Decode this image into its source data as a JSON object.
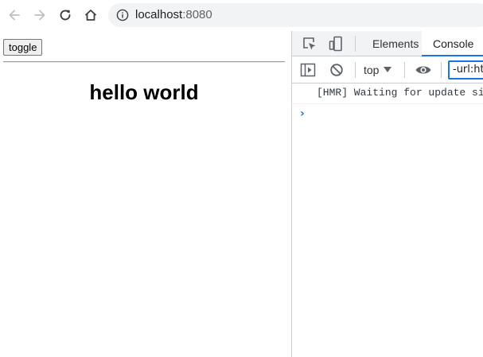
{
  "browser": {
    "url_host": "localhost",
    "url_port": ":8080",
    "colors": {
      "icon": "#5f6368",
      "icon_disabled": "#bdc1c6",
      "omnibox_bg": "#f1f3f4"
    },
    "icons": {
      "back": "arrow-left-icon",
      "forward": "arrow-right-icon",
      "reload": "reload-icon",
      "home": "home-icon",
      "site_info": "info-icon"
    }
  },
  "page": {
    "toggle_label": "toggle",
    "heading": "hello world"
  },
  "devtools": {
    "tabs": {
      "elements": "Elements",
      "console": "Console"
    },
    "active_tab": "Console",
    "console_toolbar": {
      "context": "top",
      "filter_value": "-url:http"
    },
    "messages": [
      "[HMR] Waiting for update signal from WDS..."
    ],
    "prompt": "›",
    "colors": {
      "accent": "#1a73e8",
      "panel_bg": "#f1f3f4"
    },
    "icons": {
      "inspect": "inspect-element-icon",
      "device": "device-toggle-icon",
      "sidebar": "console-sidebar-icon",
      "clear": "clear-console-icon",
      "live_expression": "eye-icon"
    }
  }
}
